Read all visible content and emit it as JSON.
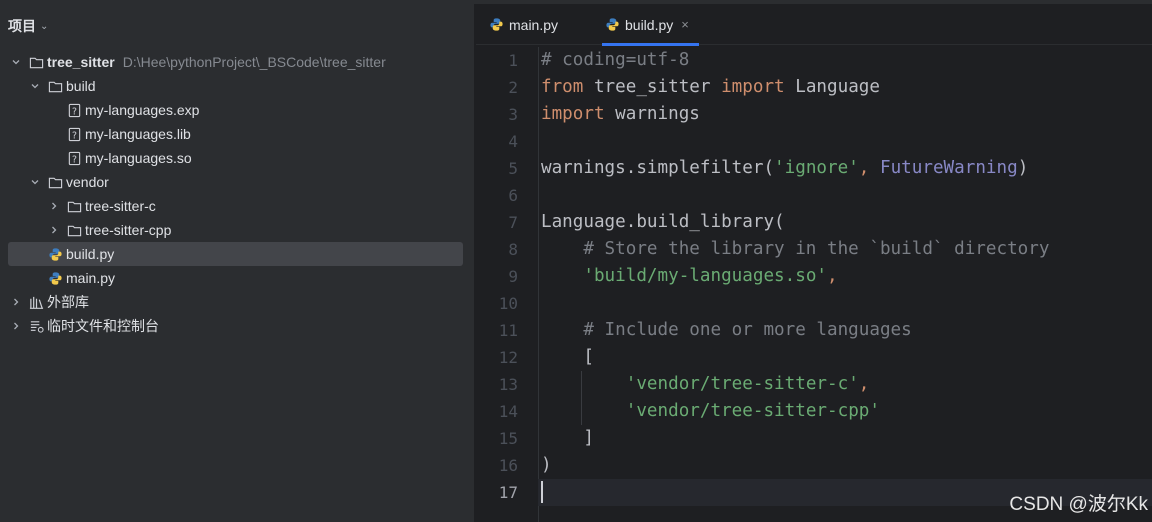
{
  "project_panel": {
    "title": "项目",
    "tree": [
      {
        "label": "tree_sitter",
        "path": "D:\\Hee\\pythonProject\\_BSCode\\tree_sitter",
        "type": "folder",
        "indent": 0,
        "expanded": true,
        "bold": true
      },
      {
        "label": "build",
        "type": "folder",
        "indent": 1,
        "expanded": true
      },
      {
        "label": "my-languages.exp",
        "type": "unknown-file",
        "indent": 2
      },
      {
        "label": "my-languages.lib",
        "type": "unknown-file",
        "indent": 2
      },
      {
        "label": "my-languages.so",
        "type": "unknown-file",
        "indent": 2
      },
      {
        "label": "vendor",
        "type": "folder",
        "indent": 1,
        "expanded": true
      },
      {
        "label": "tree-sitter-c",
        "type": "folder",
        "indent": 2,
        "expanded": false
      },
      {
        "label": "tree-sitter-cpp",
        "type": "folder",
        "indent": 2,
        "expanded": false
      },
      {
        "label": "build.py",
        "type": "python-file",
        "indent": 1,
        "selected": true
      },
      {
        "label": "main.py",
        "type": "python-file",
        "indent": 1
      },
      {
        "label": "外部库",
        "type": "library",
        "indent": 0,
        "expanded": false
      },
      {
        "label": "临时文件和控制台",
        "type": "scratches",
        "indent": 0,
        "expanded": false
      }
    ]
  },
  "editor": {
    "tabs": [
      {
        "label": "main.py",
        "active": false
      },
      {
        "label": "build.py",
        "active": true,
        "close": "×"
      }
    ],
    "current_line": 17,
    "lines": [
      [
        {
          "t": "# coding=utf-8",
          "c": "cmt"
        }
      ],
      [
        {
          "t": "from",
          "c": "kw"
        },
        {
          "t": " tree_sitter ",
          "c": ""
        },
        {
          "t": "import",
          "c": "kw"
        },
        {
          "t": " Language",
          "c": ""
        }
      ],
      [
        {
          "t": "import",
          "c": "kw"
        },
        {
          "t": " warnings",
          "c": ""
        }
      ],
      [],
      [
        {
          "t": "warnings.simplefilter(",
          "c": ""
        },
        {
          "t": "'ignore'",
          "c": "str"
        },
        {
          "t": ", ",
          "c": "kw"
        },
        {
          "t": "FutureWarning",
          "c": "cls"
        },
        {
          "t": ")",
          "c": ""
        }
      ],
      [],
      [
        {
          "t": "Language.build_library(",
          "c": ""
        }
      ],
      [
        {
          "t": "    # Store the library in the `build` directory",
          "c": "cmt"
        }
      ],
      [
        {
          "t": "    ",
          "c": ""
        },
        {
          "t": "'build/my-languages.so'",
          "c": "str"
        },
        {
          "t": ",",
          "c": "kw"
        }
      ],
      [],
      [
        {
          "t": "    # Include one or more languages",
          "c": "cmt"
        }
      ],
      [
        {
          "t": "    [",
          "c": ""
        }
      ],
      [
        {
          "t": "        ",
          "c": ""
        },
        {
          "t": "'vendor/tree-sitter-c'",
          "c": "str"
        },
        {
          "t": ",",
          "c": "kw"
        }
      ],
      [
        {
          "t": "        ",
          "c": ""
        },
        {
          "t": "'vendor/tree-sitter-cpp'",
          "c": "str"
        }
      ],
      [
        {
          "t": "    ]",
          "c": ""
        }
      ],
      [
        {
          "t": ")",
          "c": ""
        }
      ],
      []
    ]
  },
  "watermark": "CSDN @波尔Kk",
  "colors": {
    "keyword": "#cf8e6d",
    "string": "#6aab73",
    "comment": "#7a7e85",
    "builtin_class": "#8888c6",
    "accent": "#3574f0"
  }
}
